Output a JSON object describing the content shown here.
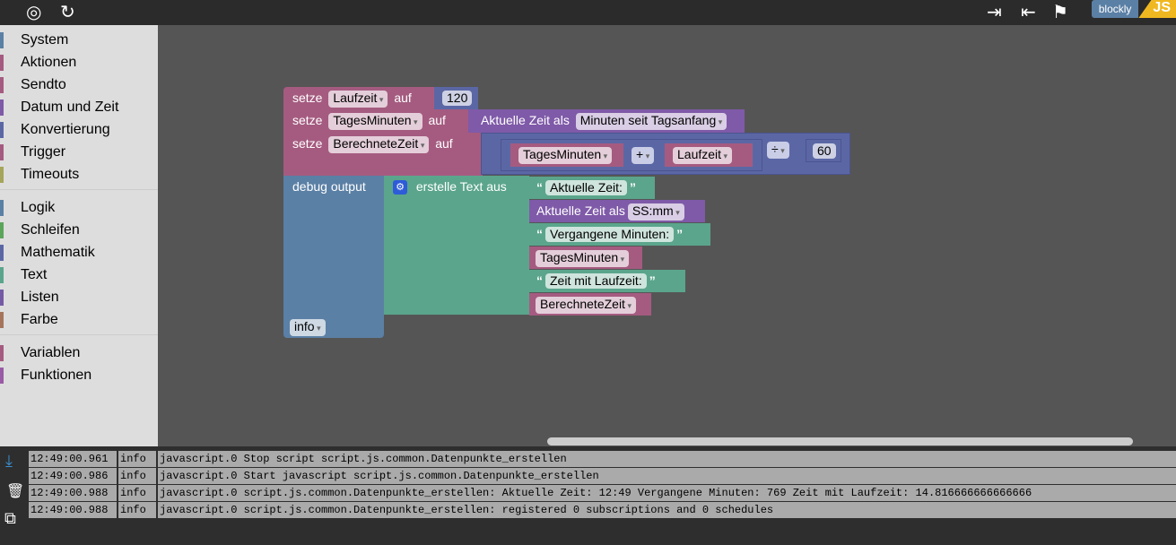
{
  "toolbar": {
    "icons": [
      "target-icon",
      "refresh-icon",
      "export-icon",
      "import-icon",
      "checkered-flag-icon"
    ],
    "brand_blockly": "blockly",
    "brand_js": "JS"
  },
  "sidebar": {
    "groups": [
      [
        {
          "label": "System",
          "color": "#5b80a5"
        },
        {
          "label": "Aktionen",
          "color": "#a55b80"
        },
        {
          "label": "Sendto",
          "color": "#a55b80"
        },
        {
          "label": "Datum und Zeit",
          "color": "#7f5aa8"
        },
        {
          "label": "Konvertierung",
          "color": "#5b67a5"
        },
        {
          "label": "Trigger",
          "color": "#a55b80"
        },
        {
          "label": "Timeouts",
          "color": "#a5a55b"
        }
      ],
      [
        {
          "label": "Logik",
          "color": "#5b80a5"
        },
        {
          "label": "Schleifen",
          "color": "#5ba55b"
        },
        {
          "label": "Mathematik",
          "color": "#5b67a5"
        },
        {
          "label": "Text",
          "color": "#5ba58c"
        },
        {
          "label": "Listen",
          "color": "#745ba5"
        },
        {
          "label": "Farbe",
          "color": "#a5745b"
        }
      ],
      [
        {
          "label": "Variablen",
          "color": "#a55b80"
        },
        {
          "label": "Funktionen",
          "color": "#995ba5"
        }
      ]
    ]
  },
  "blocks": {
    "set1": {
      "kw": "setze",
      "var": "Laufzeit",
      "auf": "auf",
      "value": "120"
    },
    "set2": {
      "kw": "setze",
      "var": "TagesMinuten",
      "auf": "auf",
      "time": "Aktuelle Zeit als",
      "format": "Minuten seit Tagsanfang"
    },
    "set3": {
      "kw": "setze",
      "var": "BerechneteZeit",
      "auf": "auf",
      "a": "TagesMinuten",
      "op1": "+",
      "b": "Laufzeit",
      "op2": "÷",
      "c": "60"
    },
    "debug": {
      "label": "debug output",
      "level": "info",
      "join": "erstelle Text aus",
      "t1": "Aktuelle Zeit:",
      "time": "Aktuelle Zeit als",
      "format": "SS:mm",
      "t2": "Vergangene Minuten:",
      "v1": "TagesMinuten",
      "t3": "Zeit mit Laufzeit:",
      "v2": "BerechneteZeit",
      "open_quote": "“",
      "close_quote": "”"
    }
  },
  "log": {
    "rows": [
      {
        "time": "12:49:00.961",
        "level": "info",
        "msg": "javascript.0 Stop script script.js.common.Datenpunkte_erstellen"
      },
      {
        "time": "12:49:00.986",
        "level": "info",
        "msg": "javascript.0 Start javascript script.js.common.Datenpunkte_erstellen"
      },
      {
        "time": "12:49:00.988",
        "level": "info",
        "msg": "javascript.0 script.js.common.Datenpunkte_erstellen: Aktuelle Zeit: 12:49 Vergangene Minuten: 769 Zeit mit Laufzeit: 14.816666666666666"
      },
      {
        "time": "12:49:00.988",
        "level": "info",
        "msg": "javascript.0 script.js.common.Datenpunkte_erstellen: registered 0 subscriptions and 0 schedules"
      }
    ]
  }
}
